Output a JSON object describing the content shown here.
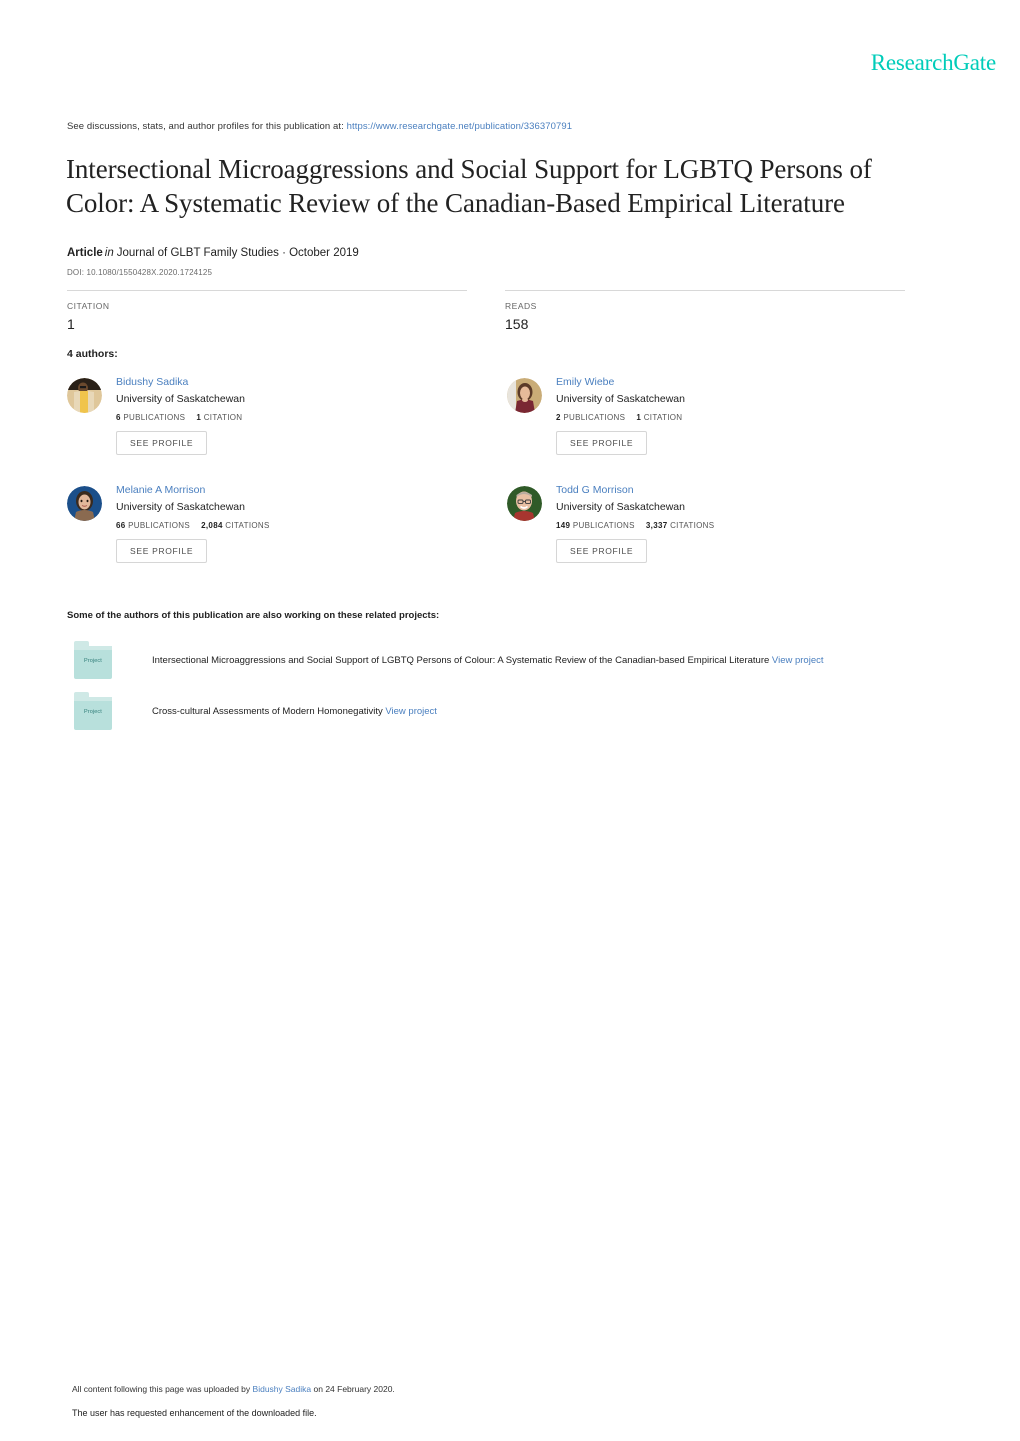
{
  "brand": {
    "logo_text": "ResearchGate",
    "logo_color": "#00ccb9"
  },
  "header": {
    "discussions_prefix": "See discussions, stats, and author profiles for this publication at:",
    "discussions_url": "https://www.researchgate.net/publication/336370791"
  },
  "publication": {
    "title": "Intersectional Microaggressions and Social Support for LGBTQ Persons of Color: A Systematic Review of the Canadian-Based Empirical Literature",
    "type_label": "Article",
    "in_label": "in",
    "venue": "Journal of GLBT Family Studies · October 2019",
    "doi": "DOI: 10.1080/1550428X.2020.1724125"
  },
  "stats": [
    {
      "label": "CITATION",
      "value": "1"
    },
    {
      "label": "READS",
      "value": "158"
    }
  ],
  "authors_section": {
    "heading": "4 authors:",
    "see_profile_label": "SEE PROFILE",
    "authors": [
      {
        "name": "Bidushy Sadika",
        "affiliation": "University of Saskatchewan",
        "publications_count": "6",
        "publications_label": "PUBLICATIONS",
        "citations_count": "1",
        "citations_label": "CITATION"
      },
      {
        "name": "Emily Wiebe",
        "affiliation": "University of Saskatchewan",
        "publications_count": "2",
        "publications_label": "PUBLICATIONS",
        "citations_count": "1",
        "citations_label": "CITATION"
      },
      {
        "name": "Melanie A Morrison",
        "affiliation": "University of Saskatchewan",
        "publications_count": "66",
        "publications_label": "PUBLICATIONS",
        "citations_count": "2,084",
        "citations_label": "CITATIONS"
      },
      {
        "name": "Todd G Morrison",
        "affiliation": "University of Saskatchewan",
        "publications_count": "149",
        "publications_label": "PUBLICATIONS",
        "citations_count": "3,337",
        "citations_label": "CITATIONS"
      }
    ]
  },
  "projects_section": {
    "heading": "Some of the authors of this publication are also working on these related projects:",
    "icon_label": "Project",
    "view_project_label": "View project",
    "projects": [
      {
        "title": "Intersectional Microaggressions and Social Support of LGBTQ Persons of Colour: A Systematic Review of the Canadian-based Empirical Literature"
      },
      {
        "title": "Cross-cultural Assessments of Modern Homonegativity"
      }
    ]
  },
  "footer": {
    "upload_prefix": "All content following this page was uploaded by",
    "uploader": "Bidushy Sadika",
    "upload_suffix": "on 24 February 2020.",
    "enhancement_note": "The user has requested enhancement of the downloaded file."
  }
}
